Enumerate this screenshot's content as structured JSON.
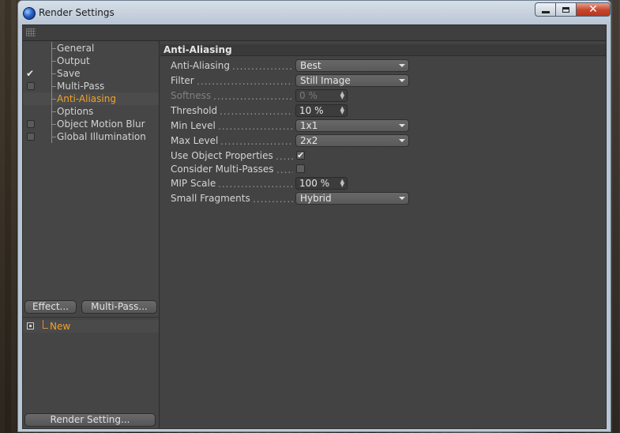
{
  "window": {
    "title": "Render Settings"
  },
  "sidebar": {
    "items": [
      {
        "label": "General",
        "checkbox": "none"
      },
      {
        "label": "Output",
        "checkbox": "none"
      },
      {
        "label": "Save",
        "checkbox": "checked"
      },
      {
        "label": "Multi-Pass",
        "checkbox": "unchecked"
      },
      {
        "label": "Anti-Aliasing",
        "checkbox": "none",
        "selected": true
      },
      {
        "label": "Options",
        "checkbox": "none"
      },
      {
        "label": "Object Motion Blur",
        "checkbox": "unchecked"
      },
      {
        "label": "Global Illumination",
        "checkbox": "unchecked"
      }
    ],
    "effect_button": "Effect...",
    "multipass_button": "Multi-Pass...",
    "settings_tree": [
      {
        "label": "New"
      }
    ],
    "render_setting_button": "Render Setting..."
  },
  "panel": {
    "title": "Anti-Aliasing",
    "rows": [
      {
        "label": "Anti-Aliasing",
        "type": "dropdown",
        "value": "Best"
      },
      {
        "label": "Filter",
        "type": "dropdown",
        "value": "Still Image"
      },
      {
        "label": "Softness",
        "type": "number",
        "value": "0 %",
        "disabled": true
      },
      {
        "label": "Threshold",
        "type": "number",
        "value": "10 %"
      },
      {
        "label": "Min Level",
        "type": "dropdown",
        "value": "1x1"
      },
      {
        "label": "Max Level",
        "type": "dropdown",
        "value": "2x2"
      },
      {
        "label": "Use Object Properties",
        "type": "checkbox",
        "checked": true
      },
      {
        "label": "Consider Multi-Passes",
        "type": "checkbox",
        "checked": false
      },
      {
        "label": "MIP Scale",
        "type": "number",
        "value": "100 %"
      },
      {
        "label": "Small Fragments",
        "type": "dropdown",
        "value": "Hybrid"
      }
    ]
  },
  "colors": {
    "accent_selected": "#f2a22a",
    "panel_bg": "#434343",
    "close_button": "#c5452c"
  },
  "icons": {
    "app": "cinema4d-sphere-icon",
    "check": "✔"
  }
}
